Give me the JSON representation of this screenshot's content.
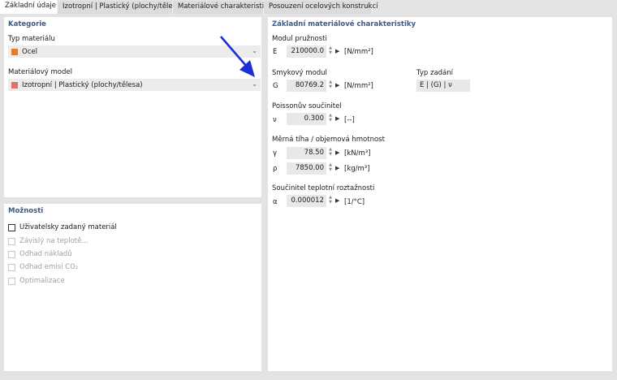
{
  "tabs": [
    {
      "label": "Základní údaje"
    },
    {
      "label": "Izotropní | Plastický (plochy/tělesa)"
    },
    {
      "label": "Materiálové charakteristiky"
    },
    {
      "label": "Posouzení ocelových konstrukcí"
    }
  ],
  "kategorie": {
    "title": "Kategorie",
    "typ_label": "Typ materiálu",
    "typ_value": "Ocel",
    "typ_color": "#f07a1a",
    "model_label": "Materiálový model",
    "model_value": "Izotropní | Plastický (plochy/tělesa)",
    "model_color": "#e07070"
  },
  "moznosti": {
    "title": "Možnosti",
    "items": [
      {
        "label": "Uživatelsky zadaný materiál",
        "enabled": true
      },
      {
        "label": "Závislý na teplotě...",
        "enabled": false
      },
      {
        "label": "Odhad nákladů",
        "enabled": false
      },
      {
        "label": "Odhad emisí CO₂",
        "enabled": false
      },
      {
        "label": "Optimalizace",
        "enabled": false
      }
    ]
  },
  "charakteristiky": {
    "title": "Základní materiálové charakteristiky",
    "modul": {
      "heading": "Modul pružnosti",
      "symbol": "E",
      "value": "210000.0",
      "unit": "[N/mm²]"
    },
    "smyk": {
      "heading": "Smykový modul",
      "symbol": "G",
      "value": "80769.2",
      "unit": "[N/mm²]"
    },
    "typ_zadani": {
      "label": "Typ zadání",
      "value": "E | (G) | ν"
    },
    "poisson": {
      "heading": "Poissonův součinitel",
      "symbol": "ν",
      "value": "0.300",
      "unit": "[--]"
    },
    "tiha": {
      "heading": "Měrná tíha / objemová hmotnost",
      "gamma": {
        "symbol": "γ",
        "value": "78.50",
        "unit": "[kN/m³]"
      },
      "rho": {
        "symbol": "ρ",
        "value": "7850.00",
        "unit": "[kg/m³]"
      }
    },
    "teplota": {
      "heading": "Součinitel teplotní roztažnosti",
      "symbol": "α",
      "value": "0.000012",
      "unit": "[1/°C]"
    }
  },
  "annotation_arrow_color": "#1a2fd6"
}
